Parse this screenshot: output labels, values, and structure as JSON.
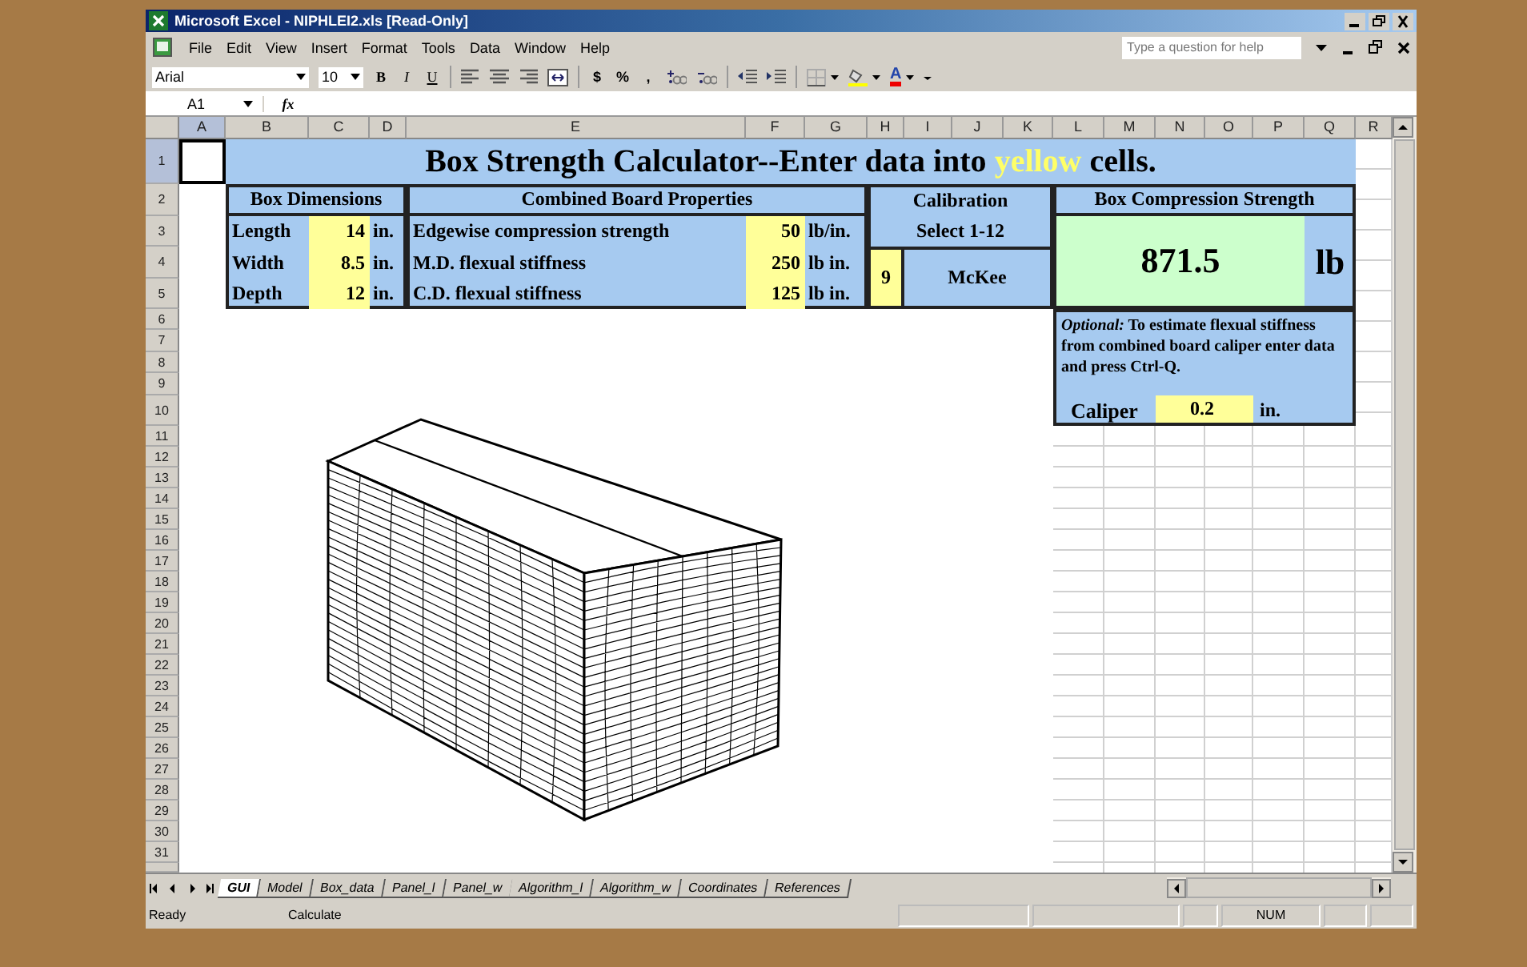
{
  "window": {
    "title": "Microsoft Excel - NIPHLEI2.xls  [Read-Only]"
  },
  "menu": [
    "File",
    "Edit",
    "View",
    "Insert",
    "Format",
    "Tools",
    "Data",
    "Window",
    "Help"
  ],
  "help": {
    "placeholder": "Type a question for help"
  },
  "toolbar": {
    "font": "Arial",
    "size": "10",
    "buttons": [
      {
        "kind": "bold",
        "label": "B"
      },
      {
        "kind": "italic",
        "label": "I"
      },
      {
        "kind": "underline",
        "label": "U"
      },
      {
        "kind": "sep"
      },
      {
        "kind": "align-left"
      },
      {
        "kind": "align-center"
      },
      {
        "kind": "align-right"
      },
      {
        "kind": "merge"
      },
      {
        "kind": "sep"
      },
      {
        "kind": "text",
        "label": "$"
      },
      {
        "kind": "text",
        "label": "%"
      },
      {
        "kind": "text",
        "label": ","
      },
      {
        "kind": "decimal-more"
      },
      {
        "kind": "decimal-less"
      },
      {
        "kind": "sep"
      },
      {
        "kind": "outdent"
      },
      {
        "kind": "indent"
      },
      {
        "kind": "sep"
      },
      {
        "kind": "borders"
      },
      {
        "kind": "fill"
      },
      {
        "kind": "font-color",
        "label": "A"
      }
    ]
  },
  "formula_bar": {
    "name_box": "A1",
    "function_label": "fx"
  },
  "columns": [
    {
      "label": "A",
      "selected": true
    },
    {
      "label": "B",
      "selected": false
    },
    {
      "label": "C",
      "selected": false
    },
    {
      "label": "D",
      "selected": false
    },
    {
      "label": "E",
      "selected": false
    },
    {
      "label": "F",
      "selected": false
    },
    {
      "label": "G",
      "selected": false
    },
    {
      "label": "H",
      "selected": false
    },
    {
      "label": "I",
      "selected": false
    },
    {
      "label": "J",
      "selected": false
    },
    {
      "label": "K",
      "selected": false
    },
    {
      "label": "L",
      "selected": false
    },
    {
      "label": "M",
      "selected": false
    },
    {
      "label": "N",
      "selected": false
    },
    {
      "label": "O",
      "selected": false
    },
    {
      "label": "P",
      "selected": false
    },
    {
      "label": "Q",
      "selected": false
    },
    {
      "label": "R",
      "selected": false
    }
  ],
  "rows": [
    {
      "label": "1",
      "selected": true
    },
    {
      "label": "2",
      "selected": false
    },
    {
      "label": "3",
      "selected": false
    },
    {
      "label": "4",
      "selected": false
    },
    {
      "label": "5",
      "selected": false
    },
    {
      "label": "6",
      "selected": false
    },
    {
      "label": "7",
      "selected": false
    },
    {
      "label": "8",
      "selected": false
    },
    {
      "label": "9",
      "selected": false
    },
    {
      "label": "10",
      "selected": false
    },
    {
      "label": "11",
      "selected": false
    },
    {
      "label": "12",
      "selected": false
    },
    {
      "label": "13",
      "selected": false
    },
    {
      "label": "14",
      "selected": false
    },
    {
      "label": "15",
      "selected": false
    },
    {
      "label": "16",
      "selected": false
    },
    {
      "label": "17",
      "selected": false
    },
    {
      "label": "18",
      "selected": false
    },
    {
      "label": "19",
      "selected": false
    },
    {
      "label": "20",
      "selected": false
    },
    {
      "label": "21",
      "selected": false
    },
    {
      "label": "22",
      "selected": false
    },
    {
      "label": "23",
      "selected": false
    },
    {
      "label": "24",
      "selected": false
    },
    {
      "label": "25",
      "selected": false
    },
    {
      "label": "26",
      "selected": false
    },
    {
      "label": "27",
      "selected": false
    },
    {
      "label": "28",
      "selected": false
    },
    {
      "label": "29",
      "selected": false
    },
    {
      "label": "30",
      "selected": false
    },
    {
      "label": "31",
      "selected": false
    }
  ],
  "calculator": {
    "title": {
      "before": "Box Strength Calculator--Enter data into ",
      "highlight": "yellow",
      "after": " cells."
    },
    "dimensions": {
      "heading": "Box Dimensions",
      "rows": [
        {
          "label": "Length",
          "value": "14",
          "unit": "in."
        },
        {
          "label": "Width",
          "value": "8.5",
          "unit": "in."
        },
        {
          "label": "Depth",
          "value": "12",
          "unit": "in."
        }
      ]
    },
    "board": {
      "heading": "Combined Board Properties",
      "rows": [
        {
          "label": "Edgewise compression strength",
          "value": "50",
          "unit": "lb/in."
        },
        {
          "label": "M.D. flexual stiffness",
          "value": "250",
          "unit": "lb in."
        },
        {
          "label": "C.D. flexual stiffness",
          "value": "125",
          "unit": "lb in."
        }
      ]
    },
    "calibration": {
      "heading": "Calibration",
      "hint": "Select 1-12",
      "value": "9",
      "method": "McKee"
    },
    "result": {
      "heading": "Box Compression Strength",
      "value": "871.5",
      "unit": "lb"
    },
    "optional": {
      "note": "*Optional:*  To estimate flexual stiffness from combined board caliper enter data and press Ctrl-Q.",
      "label": "Caliper",
      "value": "0.2",
      "unit": "in."
    }
  },
  "sheet_tabs": [
    {
      "label": "GUI",
      "selected": true
    },
    {
      "label": "Model",
      "selected": false
    },
    {
      "label": "Box_data",
      "selected": false
    },
    {
      "label": "Panel_l",
      "selected": false
    },
    {
      "label": "Panel_w",
      "selected": false
    },
    {
      "label": "Algorithm_l",
      "selected": false
    },
    {
      "label": "Algorithm_w",
      "selected": false
    },
    {
      "label": "Coordinates",
      "selected": false
    },
    {
      "label": "References",
      "selected": false
    }
  ],
  "status_bar": {
    "mode": "Ready",
    "calc": "Calculate",
    "indicator": "NUM"
  }
}
